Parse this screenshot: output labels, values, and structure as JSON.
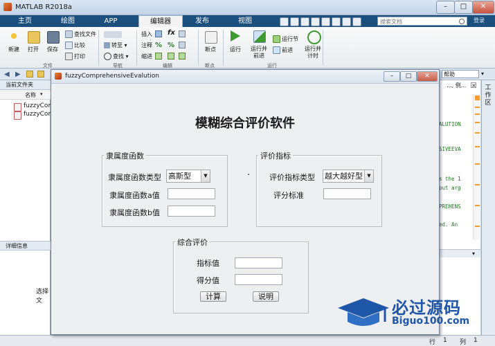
{
  "window": {
    "title": "MATLAB R2018a"
  },
  "tabs": [
    "主页",
    "绘图",
    "APP",
    "编辑器",
    "发布",
    "视图"
  ],
  "active_tab": "编辑器",
  "search": {
    "placeholder": "搜索文档"
  },
  "login_label": "登录",
  "toolbar": {
    "new": "新建",
    "open": "打开",
    "save": "保存",
    "find_files": "查找文件",
    "compare": "比较",
    "print": "打印",
    "goto": "转至",
    "find": "查找",
    "insert": "插入",
    "comment": "注释",
    "indent": "缩进",
    "breakpoints": "断点",
    "run": "运行",
    "run_advance": "运行并\n前进",
    "run_section": "运行节",
    "advance": "前进",
    "run_time": "运行并\n计时",
    "sections": [
      "文件",
      "导航",
      "编辑",
      "断点",
      "运行"
    ]
  },
  "current_folder": {
    "title": "当前文件夹",
    "col_name": "名称",
    "files": [
      "fuzzyCom",
      "fuzzyCom"
    ]
  },
  "details_title": "详细信息",
  "details_hint": "选择文",
  "help_hint": "帮助",
  "help_text": "..., 例...",
  "workspace_label": "工作区",
  "code_snippets": [
    "ALUTION",
    "SIVEEVA",
    "s the 1",
    "put arg",
    "PREHENS",
    "ed.  An"
  ],
  "status": {
    "line_label": "行",
    "line": "1",
    "col_label": "列",
    "col": "1"
  },
  "figure": {
    "title": "fuzzyComprehensiveEvalution",
    "app_title": "模糊综合评价软件",
    "membership": {
      "legend": "隶属度函数",
      "type_label": "隶属度函数类型",
      "type_value": "高斯型",
      "a_label": "隶属度函数a值",
      "b_label": "隶属度函数b值"
    },
    "index": {
      "legend": "评价指标",
      "type_label": "评价指标类型",
      "type_value": "越大越好型",
      "std_label": "评分标准"
    },
    "result": {
      "legend": "综合评价",
      "index_label": "指标值",
      "score_label": "得分值",
      "calc_button": "计算",
      "explain_button": "说明"
    }
  },
  "watermark": {
    "line1": "必过源码",
    "line2": "Biguo100.com"
  }
}
